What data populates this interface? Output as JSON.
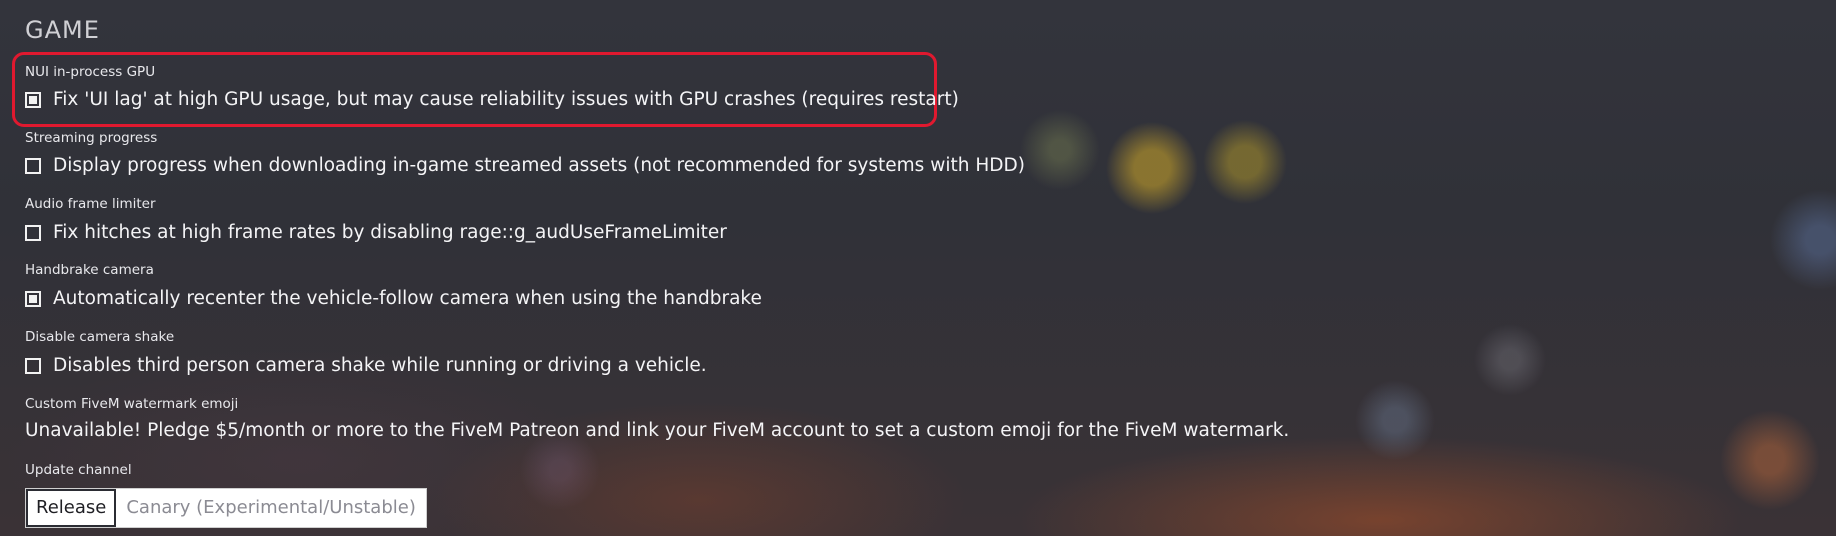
{
  "section": {
    "title": "GAME"
  },
  "settings": [
    {
      "label": "NUI in-process GPU",
      "checkbox_text": "Fix 'UI lag' at high GPU usage, but may cause reliability issues with GPU crashes (requires restart)",
      "checked": true
    },
    {
      "label": "Streaming progress",
      "checkbox_text": "Display progress when downloading in-game streamed assets (not recommended for systems with HDD)",
      "checked": false
    },
    {
      "label": "Audio frame limiter",
      "checkbox_text": "Fix hitches at high frame rates by disabling rage::g_audUseFrameLimiter",
      "checked": false
    },
    {
      "label": "Handbrake camera",
      "checkbox_text": "Automatically recenter the vehicle-follow camera when using the handbrake",
      "checked": true
    },
    {
      "label": "Disable camera shake",
      "checkbox_text": "Disables third person camera shake while running or driving a vehicle.",
      "checked": false
    }
  ],
  "watermark": {
    "label": "Custom FiveM watermark emoji",
    "text": "Unavailable! Pledge $5/month or more to the FiveM Patreon and link your FiveM account to set a custom emoji for the FiveM watermark."
  },
  "update_channel": {
    "label": "Update channel",
    "options": [
      "Release",
      "Canary (Experimental/Unstable)"
    ],
    "selected": "Release"
  },
  "colors": {
    "highlight_border": "#e0192f",
    "text": "#ffffff"
  }
}
